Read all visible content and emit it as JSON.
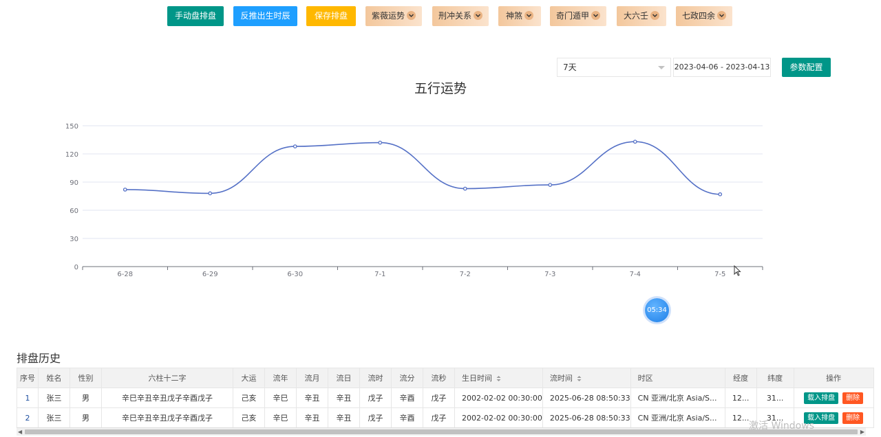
{
  "toolbar": {
    "manual": "手动盘排盘",
    "reverse": "反推出生时辰",
    "save": "保存排盘",
    "ziwei": "紫薇运势",
    "xingchong": "刑冲关系",
    "shensha": "神煞",
    "qimen": "奇门遁甲",
    "daliuren": "大六壬",
    "qizheng": "七政四余"
  },
  "filters": {
    "range": "7天",
    "dates": "2023-04-06 - 2023-04-13",
    "param_button": "参数配置"
  },
  "chart_data": {
    "type": "line",
    "title": "五行运势",
    "categories": [
      "6-28",
      "6-29",
      "6-30",
      "7-1",
      "7-2",
      "7-3",
      "7-4",
      "7-5"
    ],
    "values": [
      82,
      78,
      128,
      132,
      83,
      87,
      133,
      77
    ],
    "ylim": [
      0,
      150
    ],
    "yticks": [
      "0",
      "30",
      "60",
      "90",
      "120",
      "150"
    ],
    "smooth": true,
    "grid": true,
    "color": "#5470c6"
  },
  "timer": "05:34",
  "history": {
    "title": "排盘历史",
    "columns": [
      "序号",
      "姓名",
      "性别",
      "六柱十二字",
      "大运",
      "流年",
      "流月",
      "流日",
      "流时",
      "流分",
      "流秒",
      "生日时间",
      "流时间",
      "时区",
      "经度",
      "纬度",
      "操作"
    ],
    "rows": [
      [
        "1",
        "张三",
        "男",
        "辛巳辛丑辛丑戊子辛酉戊子",
        "己亥",
        "辛巳",
        "辛丑",
        "辛丑",
        "戊子",
        "辛酉",
        "戊子",
        "2002-02-02 00:30:00",
        "2025-06-28 08:50:33",
        "CN 亚洲/北京 Asia/S...",
        "12...",
        "31..."
      ],
      [
        "2",
        "张三",
        "男",
        "辛巳辛丑辛丑戊子辛酉戊子",
        "己亥",
        "辛巳",
        "辛丑",
        "辛丑",
        "戊子",
        "辛酉",
        "戊子",
        "2002-02-02 00:30:00",
        "2025-06-28 08:50:33",
        "CN 亚洲/北京 Asia/S...",
        "12...",
        "31..."
      ]
    ],
    "load_label": "载入排盘",
    "delete_label": "删除"
  },
  "watermark": "激活 Windows"
}
